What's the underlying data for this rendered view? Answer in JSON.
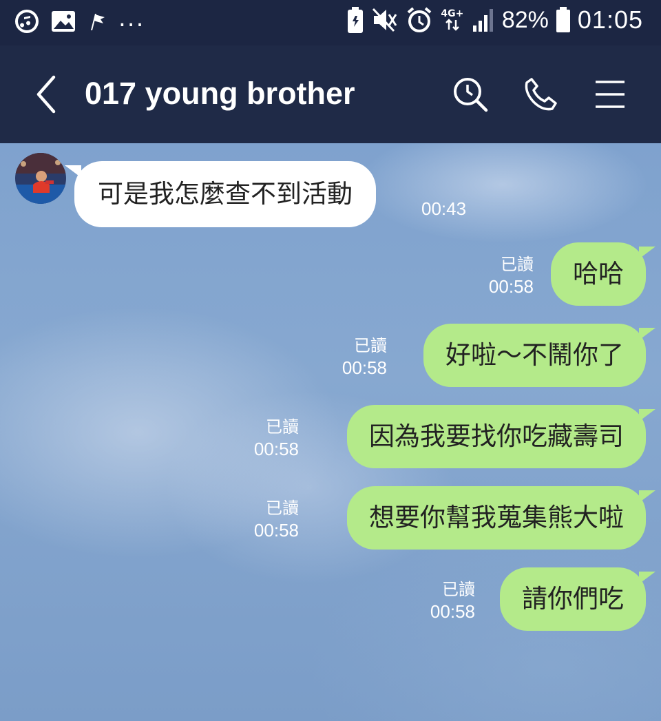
{
  "status_bar": {
    "left_icons": [
      "music-app-icon",
      "gallery-icon",
      "flag-icon",
      "more-notifications"
    ],
    "more": "...",
    "right_icons": [
      "battery-saver-icon",
      "mute-icon",
      "alarm-icon",
      "network-4g-icon",
      "signal-icon",
      "battery-icon"
    ],
    "network": "4G+",
    "battery": "82%",
    "time": "01:05"
  },
  "header": {
    "title": "017 young brother",
    "icons": [
      "back-arrow-icon",
      "search-icon",
      "phone-icon",
      "menu-icon"
    ]
  },
  "colors": {
    "header_bg": "#1f2a47",
    "status_bg": "#1c2643",
    "incoming_bubble": "#ffffff",
    "outgoing_bubble": "#b4ea8a",
    "chat_bg": "#7fa2ce"
  },
  "messages": [
    {
      "direction": "in",
      "text": "可是我怎麼查不到活動",
      "time": "00:43"
    },
    {
      "direction": "out",
      "text": "哈哈",
      "read": "已讀",
      "time": "00:58"
    },
    {
      "direction": "out",
      "text": "好啦～不鬧你了",
      "read": "已讀",
      "time": "00:58"
    },
    {
      "direction": "out",
      "text": "因為我要找你吃藏壽司",
      "read": "已讀",
      "time": "00:58"
    },
    {
      "direction": "out",
      "text": "想要你幫我蒐集熊大啦",
      "read": "已讀",
      "time": "00:58"
    },
    {
      "direction": "out",
      "text": "請你們吃",
      "read": "已讀",
      "time": "00:58"
    }
  ]
}
